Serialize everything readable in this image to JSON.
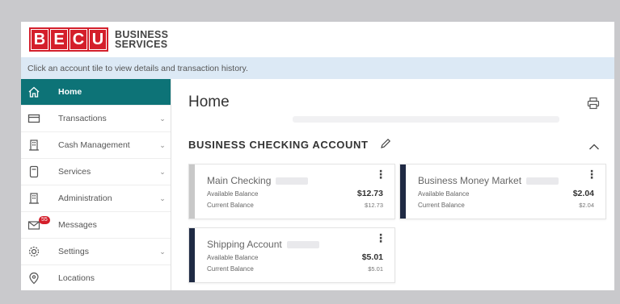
{
  "brand": {
    "letters": [
      "B",
      "E",
      "C",
      "U"
    ],
    "line1": "BUSINESS",
    "line2": "SERVICES",
    "color": "#d41f2b"
  },
  "info_text": "Click an account tile to view details and transaction history.",
  "sidebar": {
    "active_color": "#0d7377",
    "items": [
      {
        "label": "Home",
        "icon": "home-icon",
        "active": true,
        "chevron": false
      },
      {
        "label": "Transactions",
        "icon": "card-icon",
        "active": false,
        "chevron": true
      },
      {
        "label": "Cash Management",
        "icon": "building-icon",
        "active": false,
        "chevron": true
      },
      {
        "label": "Services",
        "icon": "document-icon",
        "active": false,
        "chevron": true
      },
      {
        "label": "Administration",
        "icon": "building-icon",
        "active": false,
        "chevron": true
      },
      {
        "label": "Messages",
        "icon": "envelope-icon",
        "active": false,
        "chevron": false,
        "badge": "55"
      },
      {
        "label": "Settings",
        "icon": "gear-icon",
        "active": false,
        "chevron": true
      },
      {
        "label": "Locations",
        "icon": "location-pin-icon",
        "active": false,
        "chevron": false
      }
    ]
  },
  "main": {
    "title": "Home",
    "section_title": "BUSINESS CHECKING ACCOUNT",
    "accounts": [
      {
        "name": "Main Checking",
        "bar_color": "#c8c8c8",
        "available_label": "Available Balance",
        "available": "$12.73",
        "current_label": "Current Balance",
        "current": "$12.73"
      },
      {
        "name": "Business Money Market",
        "bar_color": "#1f2a44",
        "available_label": "Available Balance",
        "available": "$2.04",
        "current_label": "Current Balance",
        "current": "$2.04"
      },
      {
        "name": "Shipping Account",
        "bar_color": "#1f2a44",
        "available_label": "Available Balance",
        "available": "$5.01",
        "current_label": "Current Balance",
        "current": "$5.01"
      }
    ]
  }
}
